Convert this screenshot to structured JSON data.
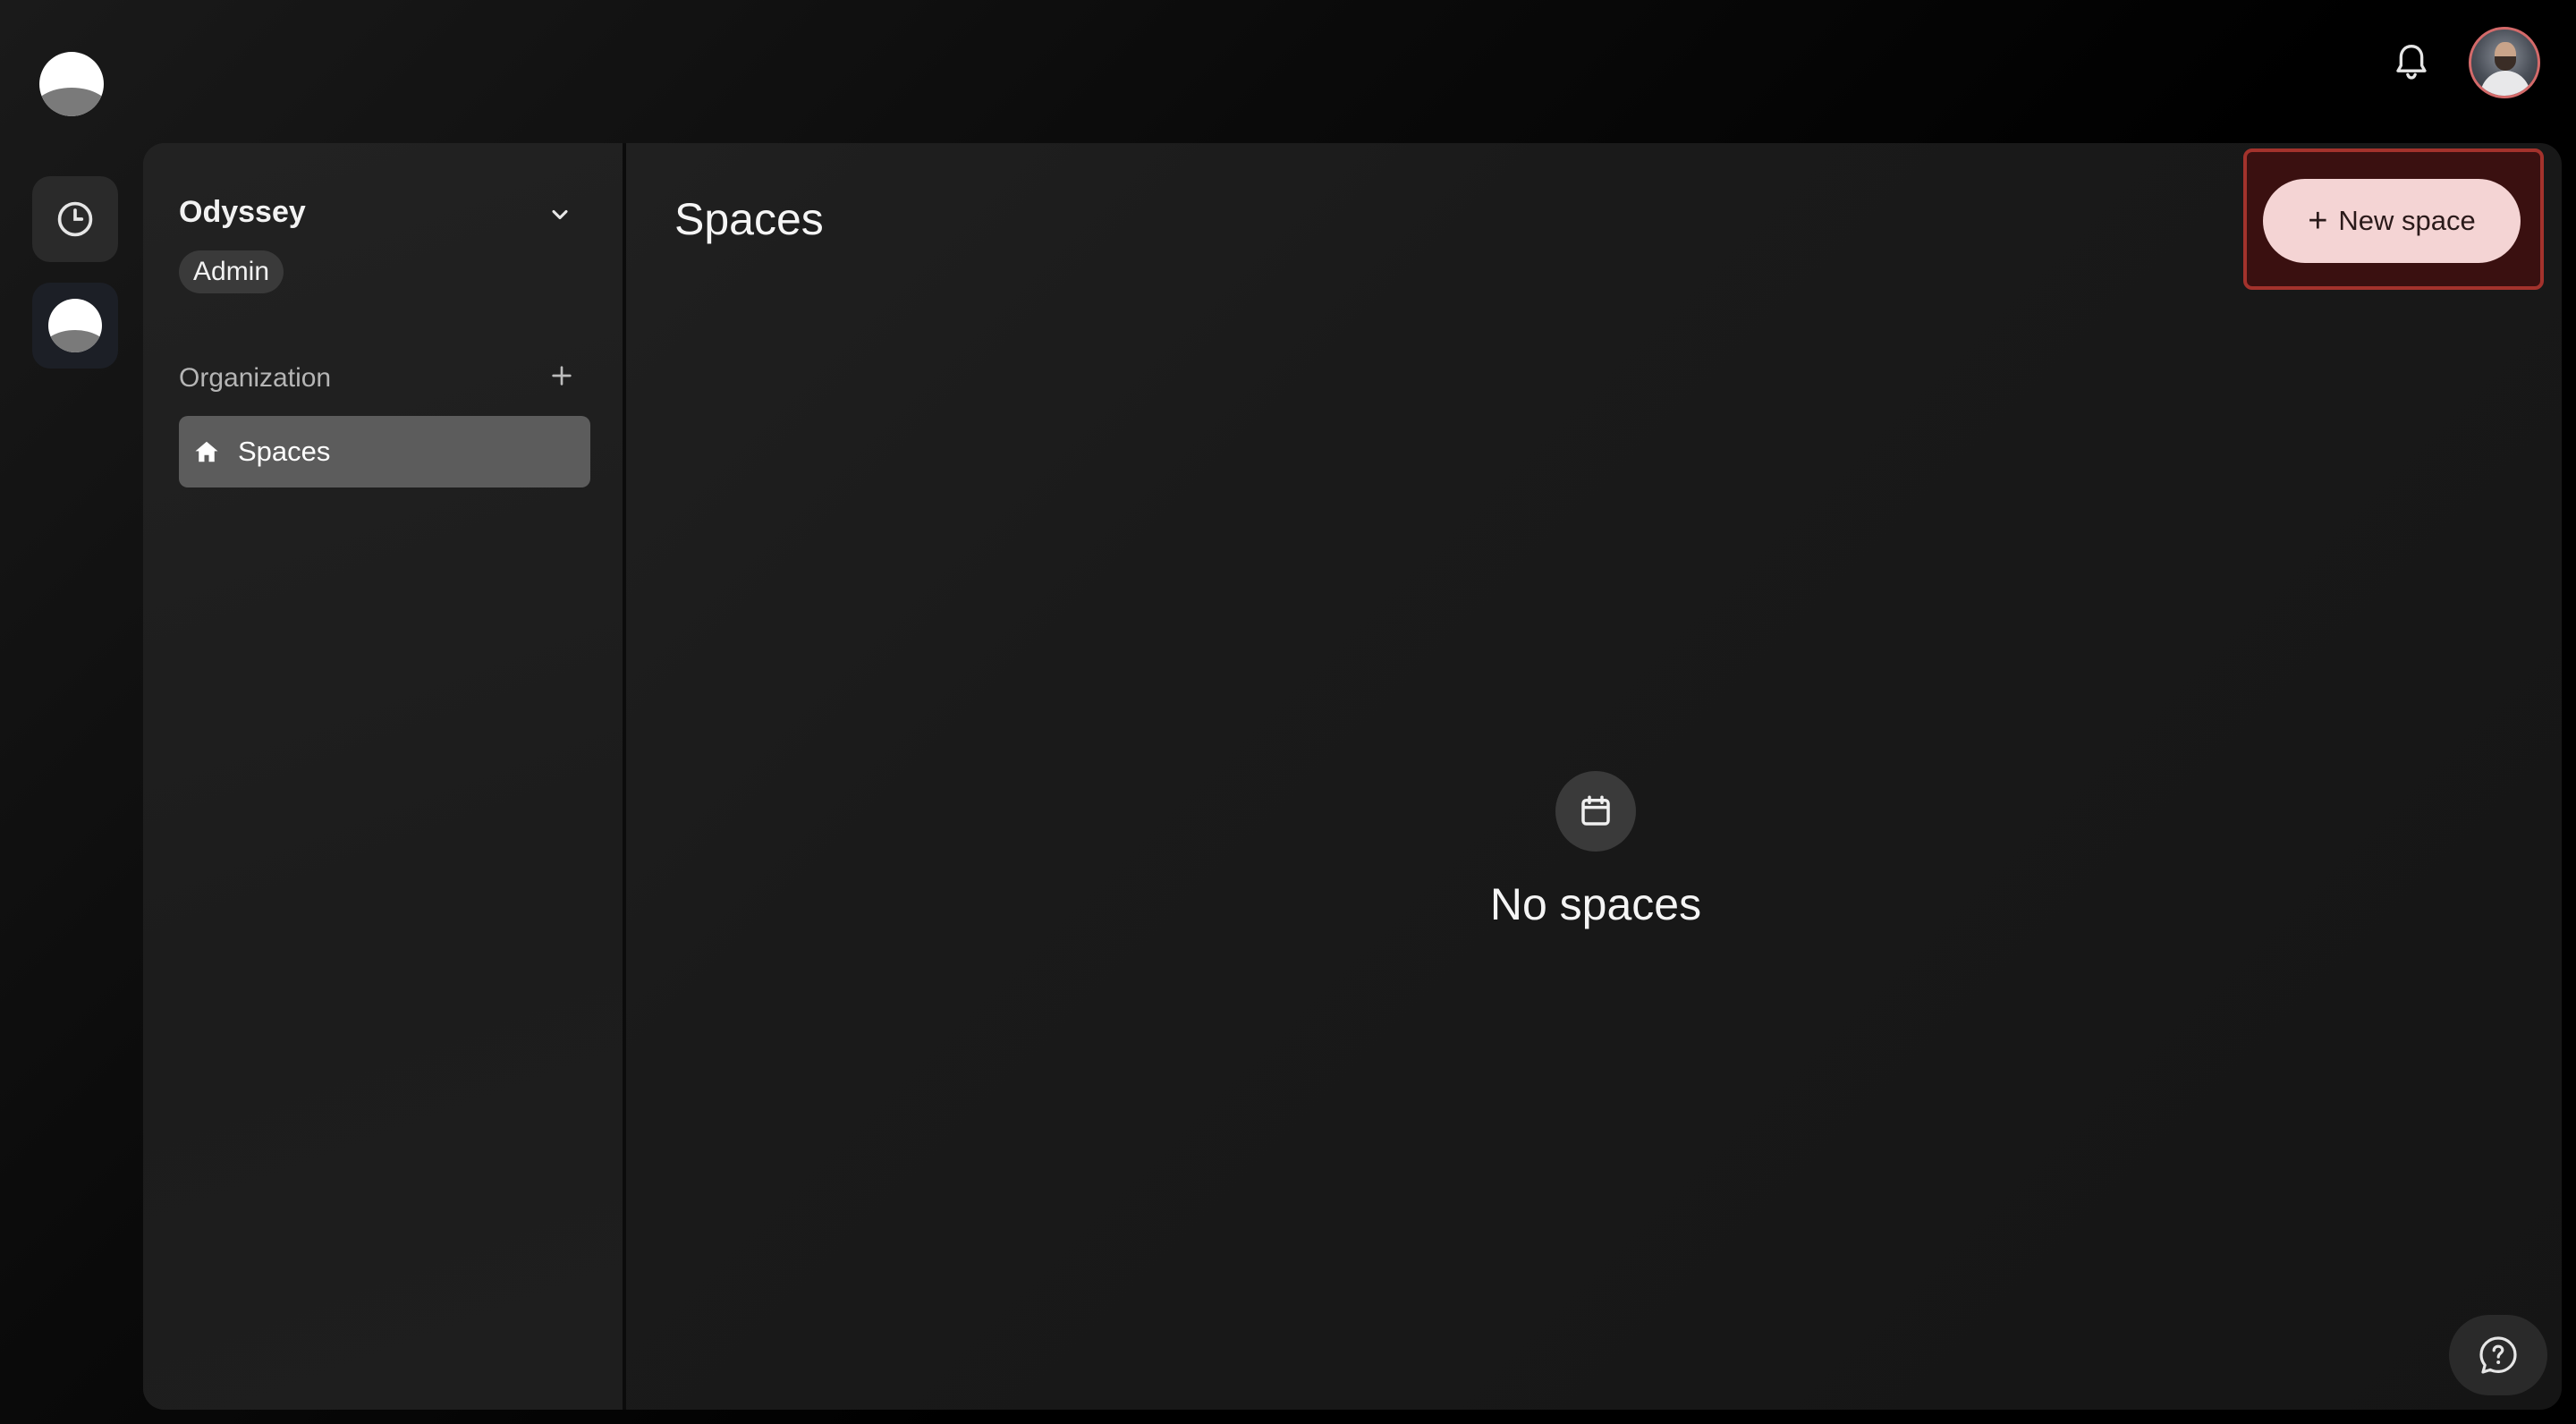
{
  "sidebar": {
    "org_name": "Odyssey",
    "role": "Admin",
    "section_label": "Organization",
    "nav_items": [
      {
        "label": "Spaces",
        "icon": "home-icon",
        "active": true
      }
    ]
  },
  "rail": {
    "items": [
      {
        "icon": "clock-icon"
      },
      {
        "icon": "workspace-logo-icon"
      }
    ]
  },
  "topbar": {
    "notification_icon": "bell-icon",
    "avatar": "user-avatar"
  },
  "main": {
    "title": "Spaces",
    "new_button_label": "New space",
    "empty_text": "No spaces",
    "empty_icon": "calendar-icon"
  },
  "colors": {
    "accent_button_bg": "#f4d4d4",
    "highlight_border": "#a3322c",
    "active_nav_bg": "#5c5c5c"
  }
}
